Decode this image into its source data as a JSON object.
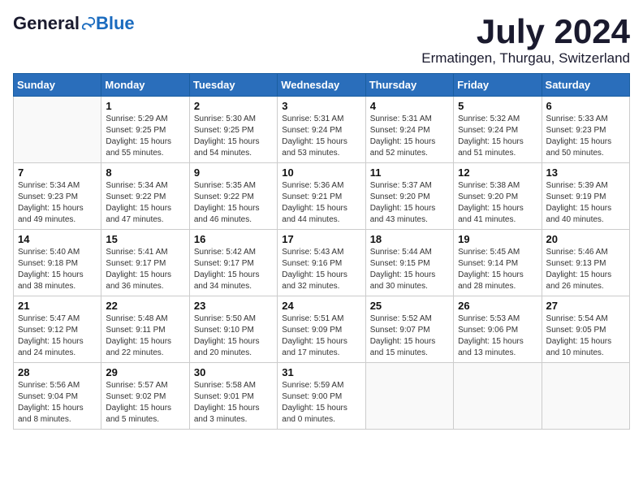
{
  "header": {
    "logo_general": "General",
    "logo_blue": "Blue",
    "month_year": "July 2024",
    "location": "Ermatingen, Thurgau, Switzerland"
  },
  "calendar": {
    "days_of_week": [
      "Sunday",
      "Monday",
      "Tuesday",
      "Wednesday",
      "Thursday",
      "Friday",
      "Saturday"
    ],
    "weeks": [
      [
        {
          "day": "",
          "empty": true
        },
        {
          "day": "1",
          "line1": "Sunrise: 5:29 AM",
          "line2": "Sunset: 9:25 PM",
          "line3": "Daylight: 15 hours",
          "line4": "and 55 minutes."
        },
        {
          "day": "2",
          "line1": "Sunrise: 5:30 AM",
          "line2": "Sunset: 9:25 PM",
          "line3": "Daylight: 15 hours",
          "line4": "and 54 minutes."
        },
        {
          "day": "3",
          "line1": "Sunrise: 5:31 AM",
          "line2": "Sunset: 9:24 PM",
          "line3": "Daylight: 15 hours",
          "line4": "and 53 minutes."
        },
        {
          "day": "4",
          "line1": "Sunrise: 5:31 AM",
          "line2": "Sunset: 9:24 PM",
          "line3": "Daylight: 15 hours",
          "line4": "and 52 minutes."
        },
        {
          "day": "5",
          "line1": "Sunrise: 5:32 AM",
          "line2": "Sunset: 9:24 PM",
          "line3": "Daylight: 15 hours",
          "line4": "and 51 minutes."
        },
        {
          "day": "6",
          "line1": "Sunrise: 5:33 AM",
          "line2": "Sunset: 9:23 PM",
          "line3": "Daylight: 15 hours",
          "line4": "and 50 minutes."
        }
      ],
      [
        {
          "day": "7",
          "line1": "Sunrise: 5:34 AM",
          "line2": "Sunset: 9:23 PM",
          "line3": "Daylight: 15 hours",
          "line4": "and 49 minutes."
        },
        {
          "day": "8",
          "line1": "Sunrise: 5:34 AM",
          "line2": "Sunset: 9:22 PM",
          "line3": "Daylight: 15 hours",
          "line4": "and 47 minutes."
        },
        {
          "day": "9",
          "line1": "Sunrise: 5:35 AM",
          "line2": "Sunset: 9:22 PM",
          "line3": "Daylight: 15 hours",
          "line4": "and 46 minutes."
        },
        {
          "day": "10",
          "line1": "Sunrise: 5:36 AM",
          "line2": "Sunset: 9:21 PM",
          "line3": "Daylight: 15 hours",
          "line4": "and 44 minutes."
        },
        {
          "day": "11",
          "line1": "Sunrise: 5:37 AM",
          "line2": "Sunset: 9:20 PM",
          "line3": "Daylight: 15 hours",
          "line4": "and 43 minutes."
        },
        {
          "day": "12",
          "line1": "Sunrise: 5:38 AM",
          "line2": "Sunset: 9:20 PM",
          "line3": "Daylight: 15 hours",
          "line4": "and 41 minutes."
        },
        {
          "day": "13",
          "line1": "Sunrise: 5:39 AM",
          "line2": "Sunset: 9:19 PM",
          "line3": "Daylight: 15 hours",
          "line4": "and 40 minutes."
        }
      ],
      [
        {
          "day": "14",
          "line1": "Sunrise: 5:40 AM",
          "line2": "Sunset: 9:18 PM",
          "line3": "Daylight: 15 hours",
          "line4": "and 38 minutes."
        },
        {
          "day": "15",
          "line1": "Sunrise: 5:41 AM",
          "line2": "Sunset: 9:17 PM",
          "line3": "Daylight: 15 hours",
          "line4": "and 36 minutes."
        },
        {
          "day": "16",
          "line1": "Sunrise: 5:42 AM",
          "line2": "Sunset: 9:17 PM",
          "line3": "Daylight: 15 hours",
          "line4": "and 34 minutes."
        },
        {
          "day": "17",
          "line1": "Sunrise: 5:43 AM",
          "line2": "Sunset: 9:16 PM",
          "line3": "Daylight: 15 hours",
          "line4": "and 32 minutes."
        },
        {
          "day": "18",
          "line1": "Sunrise: 5:44 AM",
          "line2": "Sunset: 9:15 PM",
          "line3": "Daylight: 15 hours",
          "line4": "and 30 minutes."
        },
        {
          "day": "19",
          "line1": "Sunrise: 5:45 AM",
          "line2": "Sunset: 9:14 PM",
          "line3": "Daylight: 15 hours",
          "line4": "and 28 minutes."
        },
        {
          "day": "20",
          "line1": "Sunrise: 5:46 AM",
          "line2": "Sunset: 9:13 PM",
          "line3": "Daylight: 15 hours",
          "line4": "and 26 minutes."
        }
      ],
      [
        {
          "day": "21",
          "line1": "Sunrise: 5:47 AM",
          "line2": "Sunset: 9:12 PM",
          "line3": "Daylight: 15 hours",
          "line4": "and 24 minutes."
        },
        {
          "day": "22",
          "line1": "Sunrise: 5:48 AM",
          "line2": "Sunset: 9:11 PM",
          "line3": "Daylight: 15 hours",
          "line4": "and 22 minutes."
        },
        {
          "day": "23",
          "line1": "Sunrise: 5:50 AM",
          "line2": "Sunset: 9:10 PM",
          "line3": "Daylight: 15 hours",
          "line4": "and 20 minutes."
        },
        {
          "day": "24",
          "line1": "Sunrise: 5:51 AM",
          "line2": "Sunset: 9:09 PM",
          "line3": "Daylight: 15 hours",
          "line4": "and 17 minutes."
        },
        {
          "day": "25",
          "line1": "Sunrise: 5:52 AM",
          "line2": "Sunset: 9:07 PM",
          "line3": "Daylight: 15 hours",
          "line4": "and 15 minutes."
        },
        {
          "day": "26",
          "line1": "Sunrise: 5:53 AM",
          "line2": "Sunset: 9:06 PM",
          "line3": "Daylight: 15 hours",
          "line4": "and 13 minutes."
        },
        {
          "day": "27",
          "line1": "Sunrise: 5:54 AM",
          "line2": "Sunset: 9:05 PM",
          "line3": "Daylight: 15 hours",
          "line4": "and 10 minutes."
        }
      ],
      [
        {
          "day": "28",
          "line1": "Sunrise: 5:56 AM",
          "line2": "Sunset: 9:04 PM",
          "line3": "Daylight: 15 hours",
          "line4": "and 8 minutes."
        },
        {
          "day": "29",
          "line1": "Sunrise: 5:57 AM",
          "line2": "Sunset: 9:02 PM",
          "line3": "Daylight: 15 hours",
          "line4": "and 5 minutes."
        },
        {
          "day": "30",
          "line1": "Sunrise: 5:58 AM",
          "line2": "Sunset: 9:01 PM",
          "line3": "Daylight: 15 hours",
          "line4": "and 3 minutes."
        },
        {
          "day": "31",
          "line1": "Sunrise: 5:59 AM",
          "line2": "Sunset: 9:00 PM",
          "line3": "Daylight: 15 hours",
          "line4": "and 0 minutes."
        },
        {
          "day": "",
          "empty": true
        },
        {
          "day": "",
          "empty": true
        },
        {
          "day": "",
          "empty": true
        }
      ]
    ]
  }
}
